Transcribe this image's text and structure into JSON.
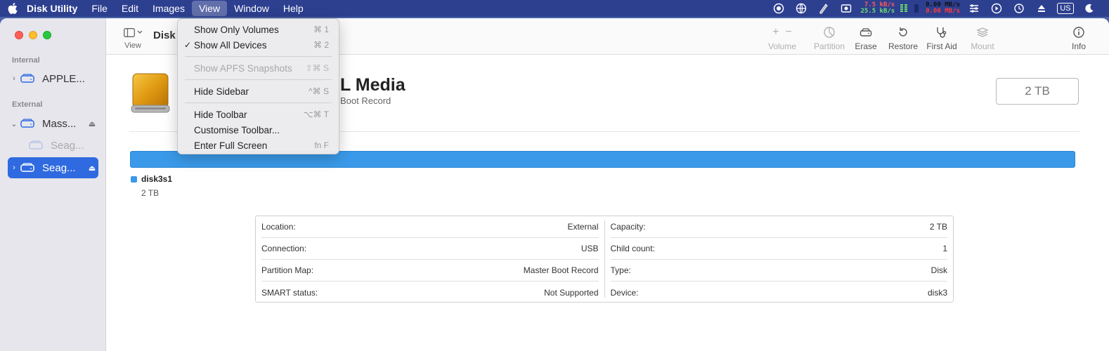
{
  "menubar": {
    "app_name": "Disk Utility",
    "items": [
      "File",
      "Edit",
      "Images",
      "View",
      "Window",
      "Help"
    ],
    "active_item": "View",
    "net_up": "7.5 kB/s",
    "net_down": "25.5 kB/s",
    "disk_read": "0.00 MB/s",
    "disk_write": "0.00 MB/s",
    "input_source": "US"
  },
  "sidebar": {
    "internal_label": "Internal",
    "external_label": "External",
    "internal_disk": "APPLE...",
    "external_disks": [
      {
        "label": "Mass..."
      },
      {
        "label": "Seag..."
      },
      {
        "label": "Seag..."
      }
    ]
  },
  "toolbar": {
    "view_label": "View",
    "title": "Disk",
    "volume_label": "Volume",
    "partition_label": "Partition",
    "erase_label": "Erase",
    "restore_label": "Restore",
    "first_aid_label": "First Aid",
    "mount_label": "Mount",
    "info_label": "Info"
  },
  "disk": {
    "name": "L Media",
    "subtitle": "Boot Record",
    "capacity": "2 TB",
    "partition_name": "disk3s1",
    "partition_size": "2 TB"
  },
  "info": {
    "left": [
      {
        "label": "Location:",
        "value": "External"
      },
      {
        "label": "Connection:",
        "value": "USB"
      },
      {
        "label": "Partition Map:",
        "value": "Master Boot Record"
      },
      {
        "label": "SMART status:",
        "value": "Not Supported"
      }
    ],
    "right": [
      {
        "label": "Capacity:",
        "value": "2 TB"
      },
      {
        "label": "Child count:",
        "value": "1"
      },
      {
        "label": "Type:",
        "value": "Disk"
      },
      {
        "label": "Device:",
        "value": "disk3"
      }
    ]
  },
  "view_menu": {
    "show_only_volumes": {
      "label": "Show Only Volumes",
      "shortcut": "⌘ 1"
    },
    "show_all_devices": {
      "label": "Show All Devices",
      "shortcut": "⌘ 2",
      "check": "✓"
    },
    "show_apfs_snapshots": {
      "label": "Show APFS Snapshots",
      "shortcut": "⇧⌘ S"
    },
    "hide_sidebar": {
      "label": "Hide Sidebar",
      "shortcut": "^⌘ S"
    },
    "hide_toolbar": {
      "label": "Hide Toolbar",
      "shortcut": "⌥⌘ T"
    },
    "customise_toolbar": {
      "label": "Customise Toolbar..."
    },
    "enter_full_screen": {
      "label": "Enter Full Screen",
      "shortcut": "fn F"
    }
  },
  "colors": {
    "accent": "#2f6ae0",
    "usage_bar": "#3a9ae9",
    "menubar": "#2d3f8f"
  }
}
